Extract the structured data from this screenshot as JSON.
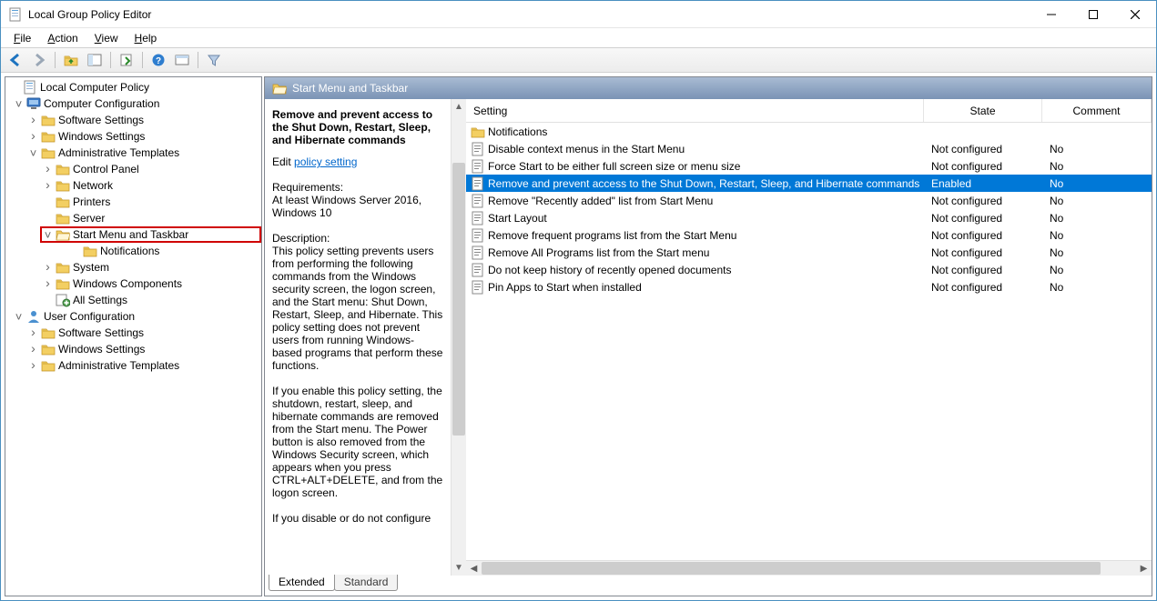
{
  "window": {
    "title": "Local Group Policy Editor"
  },
  "menu": {
    "file": "File",
    "action": "Action",
    "view": "View",
    "help": "Help"
  },
  "tree": {
    "root": "Local Computer Policy",
    "comp_conf": "Computer Configuration",
    "software_settings": "Software Settings",
    "windows_settings": "Windows Settings",
    "admin_templates": "Administrative Templates",
    "control_panel": "Control Panel",
    "network": "Network",
    "printers": "Printers",
    "server": "Server",
    "start_menu_taskbar": "Start Menu and Taskbar",
    "notifications": "Notifications",
    "system": "System",
    "windows_components": "Windows Components",
    "all_settings": "All Settings",
    "user_conf": "User Configuration",
    "u_software_settings": "Software Settings",
    "u_windows_settings": "Windows Settings",
    "u_admin_templates": "Administrative Templates"
  },
  "right_header": "Start Menu and Taskbar",
  "desc": {
    "title": "Remove and prevent access to the Shut Down, Restart, Sleep, and Hibernate commands",
    "edit_prefix": "Edit ",
    "edit_link": "policy setting ",
    "req_label": "Requirements:",
    "req_text": "At least Windows Server 2016, Windows 10",
    "desc_label": "Description:",
    "desc_text": "This policy setting prevents users from performing the following commands from the Windows security screen, the logon screen, and the Start menu: Shut Down, Restart, Sleep, and Hibernate. This policy setting does not prevent users from running Windows-based programs that perform these functions.",
    "desc_text2": "If you enable this policy setting, the shutdown, restart, sleep, and hibernate commands are removed from the Start menu. The Power button is also removed from the Windows Security screen, which appears when you press CTRL+ALT+DELETE, and from the logon screen.",
    "desc_text3": "If you disable or do not configure"
  },
  "columns": {
    "setting": "Setting",
    "state": "State",
    "comment": "Comment"
  },
  "rows": [
    {
      "type": "folder",
      "label": "Notifications",
      "state": "",
      "comment": ""
    },
    {
      "type": "policy",
      "label": "Disable context menus in the Start Menu",
      "state": "Not configured",
      "comment": "No"
    },
    {
      "type": "policy",
      "label": "Force Start to be either full screen size or menu size",
      "state": "Not configured",
      "comment": "No"
    },
    {
      "type": "policy",
      "label": "Remove and prevent access to the Shut Down, Restart, Sleep, and Hibernate commands",
      "state": "Enabled",
      "comment": "No",
      "selected": true
    },
    {
      "type": "policy",
      "label": "Remove \"Recently added\" list from Start Menu",
      "state": "Not configured",
      "comment": "No"
    },
    {
      "type": "policy",
      "label": "Start Layout",
      "state": "Not configured",
      "comment": "No"
    },
    {
      "type": "policy",
      "label": "Remove frequent programs list from the Start Menu",
      "state": "Not configured",
      "comment": "No"
    },
    {
      "type": "policy",
      "label": "Remove All Programs list from the Start menu",
      "state": "Not configured",
      "comment": "No"
    },
    {
      "type": "policy",
      "label": "Do not keep history of recently opened documents",
      "state": "Not configured",
      "comment": "No"
    },
    {
      "type": "policy",
      "label": "Pin Apps to Start when installed",
      "state": "Not configured",
      "comment": "No"
    }
  ],
  "tabs": {
    "extended": "Extended",
    "standard": "Standard"
  }
}
